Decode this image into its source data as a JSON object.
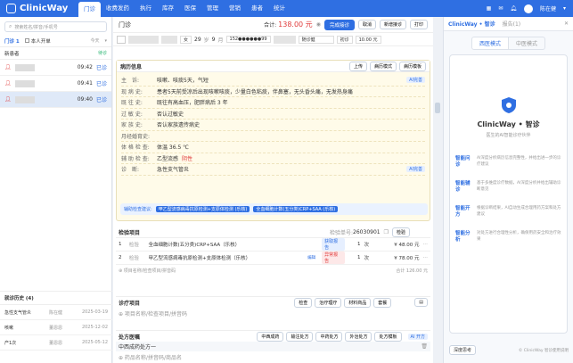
{
  "app": {
    "name": "ClinicWay"
  },
  "nav": {
    "items": [
      "门诊",
      "收费发药",
      "执行",
      "库存",
      "医保",
      "管理",
      "营销",
      "患者",
      "统计"
    ],
    "active": 0
  },
  "header_right": {
    "user": "陈在健"
  },
  "left": {
    "search_placeholder": "搜索姓名/拼音/手机号",
    "tabs": [
      "门诊 1",
      "本人开单"
    ],
    "today": "今天",
    "new_patient": "新患者",
    "pending": "待诊",
    "patients": [
      {
        "time": "09:42",
        "status": "已诊"
      },
      {
        "time": "09:41",
        "status": "已诊"
      },
      {
        "time": "09:40",
        "status": "已诊"
      }
    ],
    "history_title": "就诊历史 (4)",
    "history": [
      {
        "diag": "急性支气管炎",
        "doctor": "陈在健",
        "date": "2025-03-19"
      },
      {
        "diag": "咳嗽",
        "doctor": "董恩恩",
        "date": "2025-12-02"
      },
      {
        "diag": "产1次",
        "doctor": "董恩恩",
        "date": "2025-05-12"
      }
    ]
  },
  "main": {
    "title": "门诊",
    "total_label": "合计:",
    "total_value": "138.00 元",
    "btn_done": "完成接诊",
    "btn_cancel": "取消",
    "btn_new": "新增接诊",
    "btn_print": "打印",
    "patient": {
      "gender": "女",
      "age1": "29",
      "age_unit1": "岁",
      "age2": "9",
      "age_unit2": "月",
      "phone": "152●●●●●●99",
      "type": "随诊健",
      "visit": "初诊",
      "fee": "10.00 元"
    },
    "record": {
      "title": "病历信息",
      "btn_up": "上传",
      "btn_mode": "病历模式",
      "btn_template": "病历模板",
      "ai": "AI完善",
      "fields": [
        {
          "label": "主　诉:",
          "value": "咳嗽、咳痰5天，气短"
        },
        {
          "label": "现 病 史:",
          "value": "患者5天前受凉后出现咳嗽咳痰，少量白色粘痰，伴鼻塞，无头昏头痛，无发热身痛"
        },
        {
          "label": "既 往 史:",
          "value": "既往有高血压，肥胖病后 3 年"
        },
        {
          "label": "过 敏 史:",
          "value": "否认过敏史"
        },
        {
          "label": "家 族 史:",
          "value": "否认家族遗传病史"
        },
        {
          "label": "月经婚育史:",
          "value": ""
        },
        {
          "label": "体 格 检 查:",
          "value": "体温 36.5 ℃"
        },
        {
          "label": "辅 助 检 查:",
          "value": "乙型流感"
        },
        {
          "label": "诊　断:",
          "value": "急性支气管炎"
        }
      ],
      "aux_note": "阴性",
      "suggest_label": "辅助检查建议:",
      "suggest": [
        "甲乙型流感病毒抗原检测+支原体检测 (乐核)",
        "全血细胞计数(五分类)CRP+SAA (乐核)"
      ]
    },
    "checks": {
      "title": "检验项目",
      "order_label": "检验单号:",
      "order_no": "26030901",
      "btn": "检验",
      "rows": [
        {
          "no": "1",
          "type": "检验",
          "name": "全血细胞计数(五分类)CRP+SAA（乐核）",
          "status": "获取报告",
          "qty": "1",
          "unit": "次",
          "price": "¥ 48.00 元"
        },
        {
          "no": "2",
          "type": "检验",
          "name": "甲乙型流感病毒抗原检测+支原体检测（乐核）",
          "status": "异常报告",
          "status2": "编辑",
          "qty": "1",
          "unit": "次",
          "price": "¥ 78.00 元"
        }
      ],
      "add_placeholder": "⊕ 项目名称/检查项目/拼音码",
      "subtotal": "合计 126.00 元"
    },
    "treat": {
      "title": "诊疗项目",
      "btns": [
        "检查",
        "治疗理疗",
        "材料商品",
        "套餐"
      ],
      "add_placeholder": "⊕ 项目名称/检查项目/拼音码"
    },
    "rx": {
      "title": "处方医嘱",
      "btns": [
        "中西成药",
        "输注处方",
        "中药处方",
        "外治处方",
        "处方模板"
      ],
      "ai": "AI 开方",
      "item": "中西成药处方一",
      "add_placeholder": "⊕ 药品名称/拼音码/商品名"
    }
  },
  "right": {
    "tabs": [
      "ClinicWay • 智诊",
      "报告(1)"
    ],
    "modes": [
      "西医模式",
      "中医模式"
    ],
    "brand": "ClinicWay • 智诊",
    "brand_sub": "医生的AI智能诊疗伙伴",
    "features": [
      {
        "title": "智能问诊",
        "desc": "AI深度分析病历信息完整性，并给出进一步的诊疗建议"
      },
      {
        "title": "智能辅诊",
        "desc": "基于多维度诊疗数据，AI深度分析并给出辅助诊断意见"
      },
      {
        "title": "智能开方",
        "desc": "根据诊断结果，AI自动生成合理用药方案和处方建议"
      },
      {
        "title": "智能分析",
        "desc": "对处方进行合理性分析，确保用药安全和治疗效果"
      }
    ],
    "footer_btn": "深度思考",
    "footer_note": "© ClinicWay 智诊使用说明"
  },
  "colors": {
    "primary": "#2f6fe2",
    "record_bg": "#fffbe9",
    "danger": "#e03b3b"
  }
}
